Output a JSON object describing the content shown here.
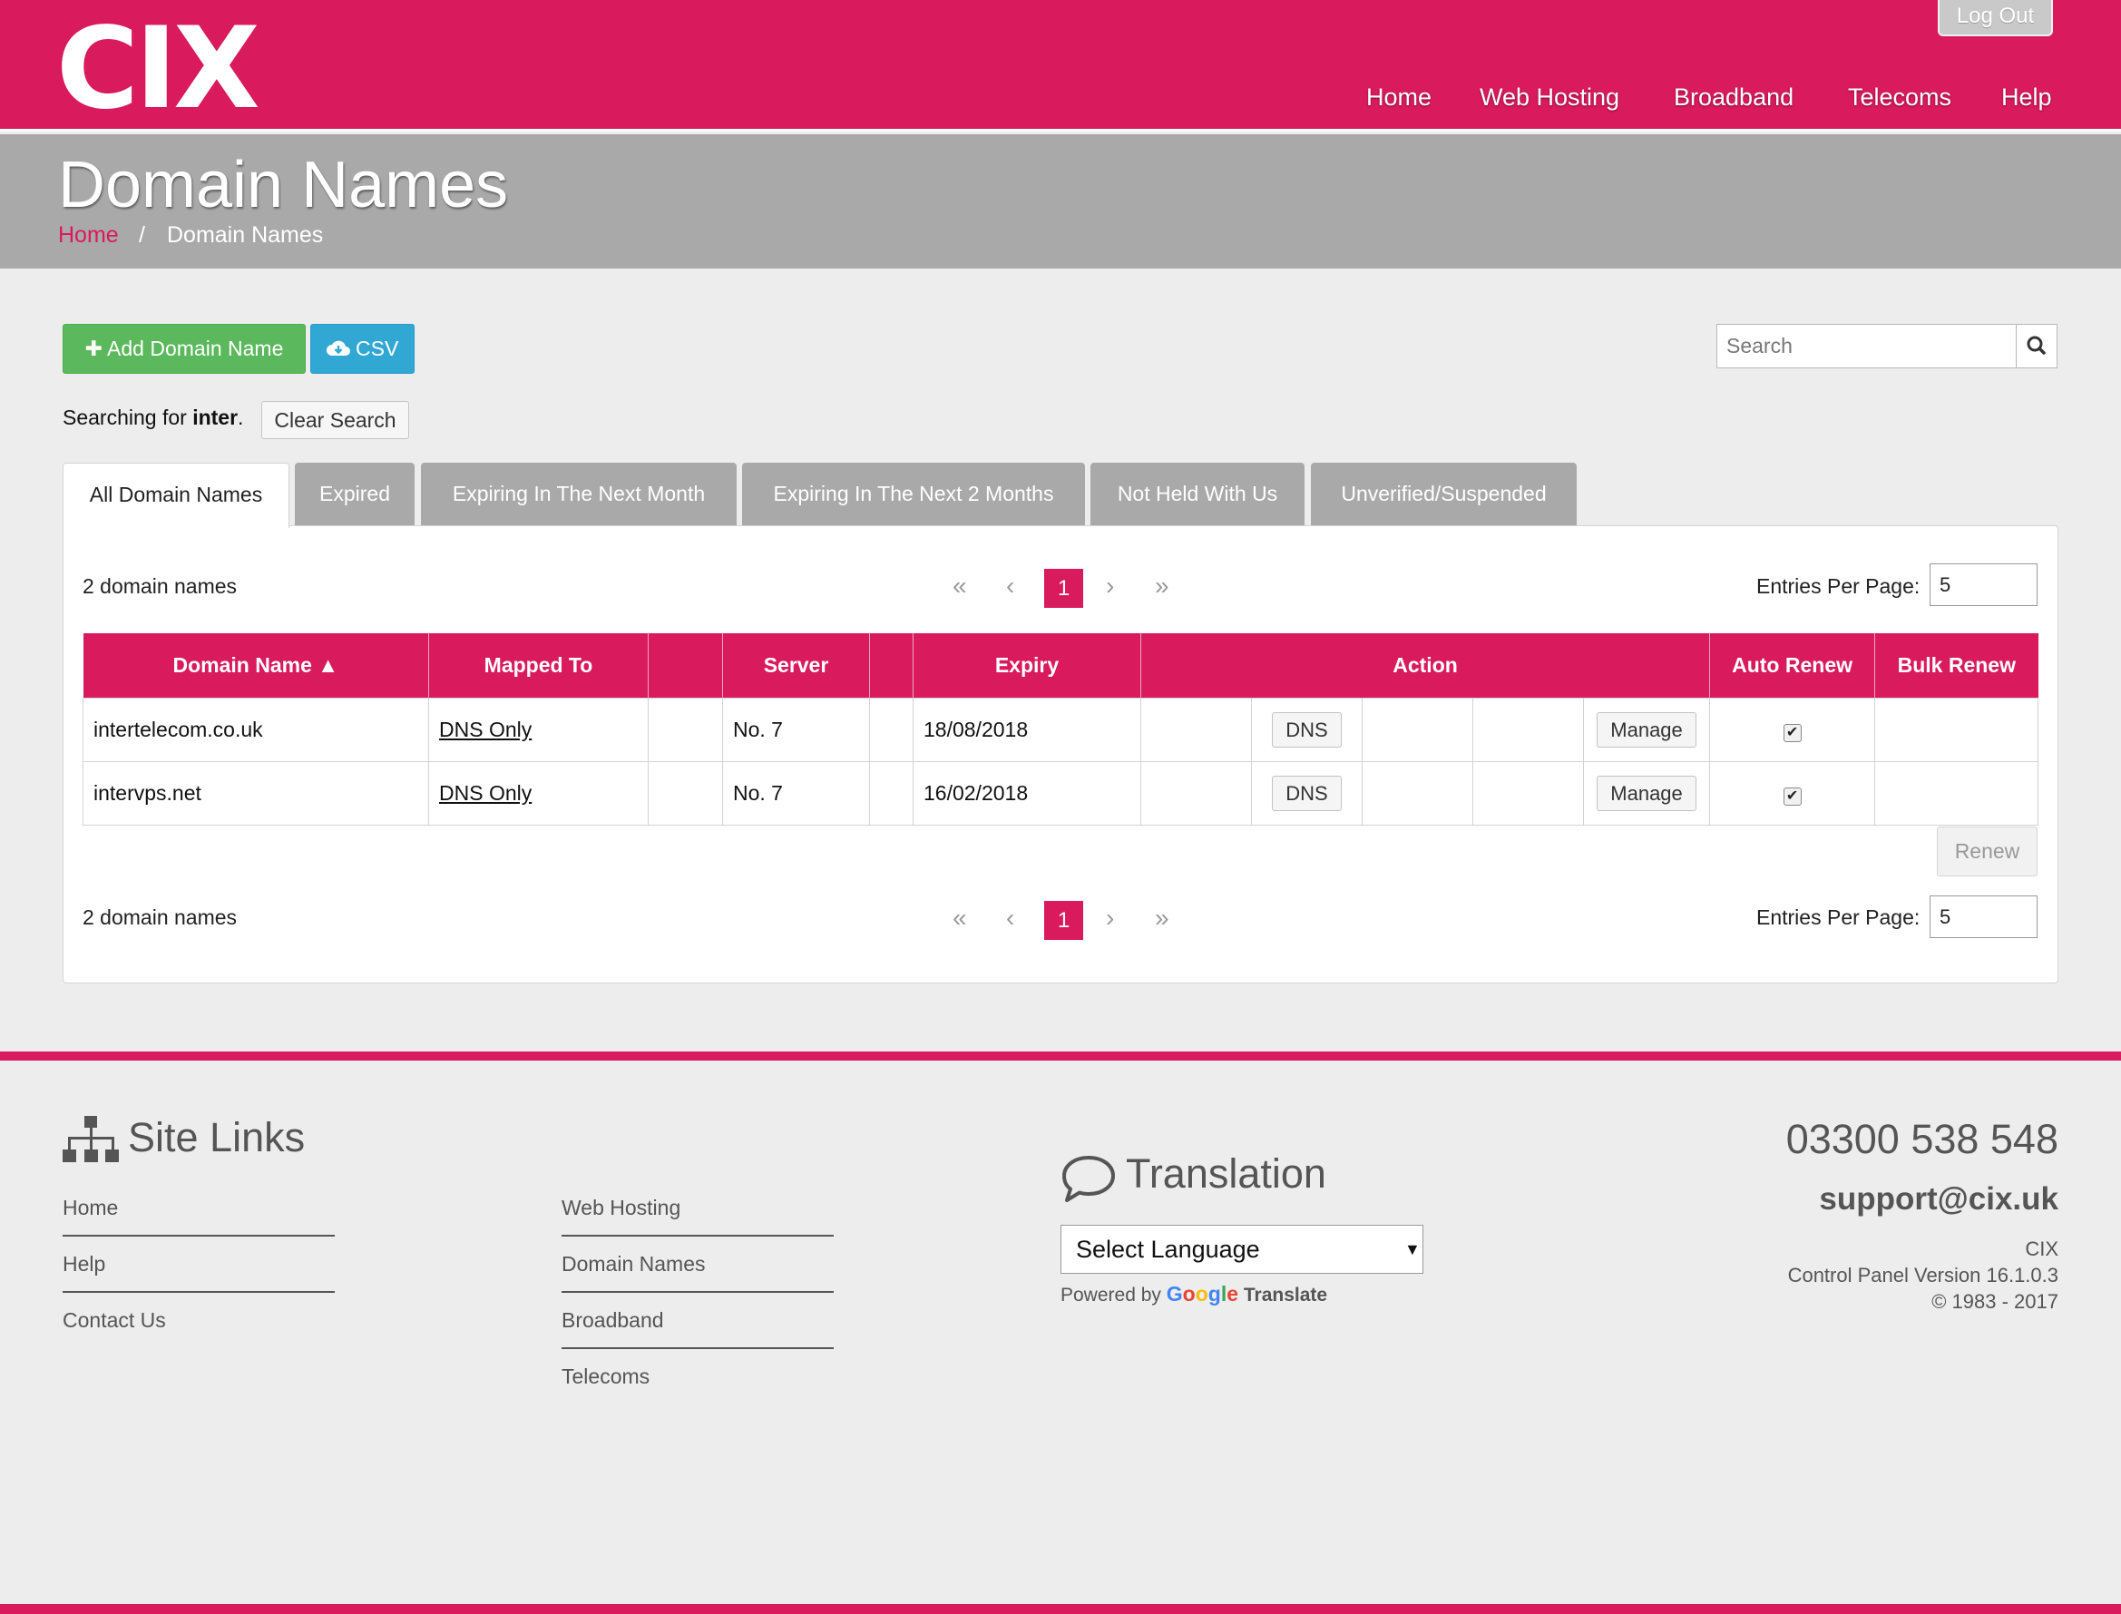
{
  "brand": {
    "logo_text": "CIX",
    "accent_color": "#d91a5c"
  },
  "header": {
    "logout_label": "Log Out",
    "nav": [
      "Home",
      "Web Hosting",
      "Broadband",
      "Telecoms",
      "Help"
    ]
  },
  "page": {
    "title": "Domain Names",
    "breadcrumb": {
      "home": "Home",
      "separator": "/",
      "current": "Domain Names"
    }
  },
  "toolbar": {
    "add_label": "Add Domain Name",
    "csv_label": "CSV",
    "search_placeholder": "Search"
  },
  "search_state": {
    "prefix": "Searching for",
    "term": "inter",
    "suffix": ".",
    "clear_label": "Clear Search"
  },
  "tabs": [
    {
      "label": "All Domain Names",
      "active": true
    },
    {
      "label": "Expired",
      "active": false
    },
    {
      "label": "Expiring In The Next Month",
      "active": false
    },
    {
      "label": "Expiring In The Next 2 Months",
      "active": false
    },
    {
      "label": "Not Held With Us",
      "active": false
    },
    {
      "label": "Unverified/Suspended",
      "active": false
    }
  ],
  "list": {
    "count_text": "2 domain names",
    "current_page": "1",
    "entries_label": "Entries Per Page:",
    "entries_value": "5",
    "renew_label": "Renew",
    "columns": [
      "Domain Name",
      "Mapped To",
      "Server",
      "Expiry",
      "Action",
      "Auto Renew",
      "Bulk Renew"
    ],
    "sort_indicator": "ascending",
    "rows": [
      {
        "domain": "intertelecom.co.uk",
        "mapped_to": "DNS Only",
        "server": "No. 7",
        "expiry": "18/08/2018",
        "dns_label": "DNS",
        "manage_label": "Manage",
        "auto_renew": true
      },
      {
        "domain": "intervps.net",
        "mapped_to": "DNS Only",
        "server": "No. 7",
        "expiry": "16/02/2018",
        "dns_label": "DNS",
        "manage_label": "Manage",
        "auto_renew": true
      }
    ]
  },
  "footer": {
    "site_links_title": "Site Links",
    "links_col1": [
      "Home",
      "Help",
      "Contact Us"
    ],
    "links_col2": [
      "Web Hosting",
      "Domain Names",
      "Broadband",
      "Telecoms"
    ],
    "translation_title": "Translation",
    "select_language": "Select Language",
    "powered_by": "Powered by",
    "google_word": "Google",
    "translate_word": "Translate",
    "phone": "03300 538 548",
    "email": "support@cix.uk",
    "company": "CIX",
    "version": "Control Panel Version 16.1.0.3",
    "copyright": "© 1983 - 2017"
  }
}
